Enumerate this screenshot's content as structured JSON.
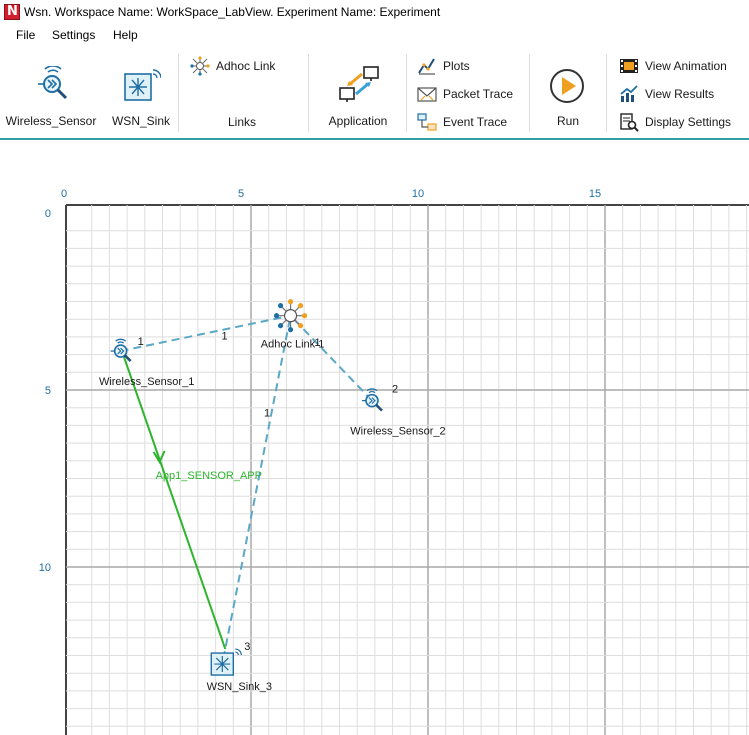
{
  "window": {
    "title": "Wsn. Workspace Name: WorkSpace_LabView. Experiment Name: Experiment",
    "logo_letter": "N"
  },
  "menu": {
    "items": [
      "File",
      "Settings",
      "Help"
    ]
  },
  "ribbon": {
    "wireless_sensor": "Wireless_Sensor",
    "wsn_sink": "WSN_Sink",
    "adhoc_link": "Adhoc Link",
    "links_group": "Links",
    "application": "Application",
    "plots": "Plots",
    "packet_trace": "Packet Trace",
    "event_trace": "Event Trace",
    "run": "Run",
    "view_animation": "View Animation",
    "view_results": "View Results",
    "display_settings": "Display Settings"
  },
  "colors": {
    "accent": "#2f9ea7",
    "link_dashed": "#5aa7c7",
    "app_flow": "#2db52d",
    "axis_tick": "#1f6fa5",
    "run_icon": "#f0a020"
  },
  "grid": {
    "x_ticks": [
      "0",
      "5",
      "10",
      "15"
    ],
    "y_ticks": [
      "0",
      "5",
      "10"
    ],
    "x_range": [
      0,
      19
    ],
    "y_range": [
      0,
      14.4
    ]
  },
  "nodes": [
    {
      "id": "ws1",
      "label": "Wireless_Sensor_1",
      "number": "1",
      "icon": "wireless-sensor-icon",
      "x": 1.6,
      "y": 3.9
    },
    {
      "id": "ws2",
      "label": "Wireless_Sensor_2",
      "number": "2",
      "icon": "wireless-sensor-icon",
      "x": 8.7,
      "y": 5.3
    },
    {
      "id": "sink",
      "label": "WSN_Sink_3",
      "number": "3",
      "icon": "wsn-sink-icon",
      "x": 4.5,
      "y": 12.6
    },
    {
      "id": "link",
      "label": "Adhoc Link 1",
      "number": "",
      "icon": "adhoc-link-icon",
      "x": 6.4,
      "y": 2.9
    }
  ],
  "links": [
    {
      "from": "ws1",
      "label": "1"
    },
    {
      "from": "ws2",
      "label": "1"
    },
    {
      "from": "sink",
      "label": "1"
    }
  ],
  "application": {
    "label": "App1_SENSOR_APP",
    "from": "ws1",
    "to": "sink"
  }
}
